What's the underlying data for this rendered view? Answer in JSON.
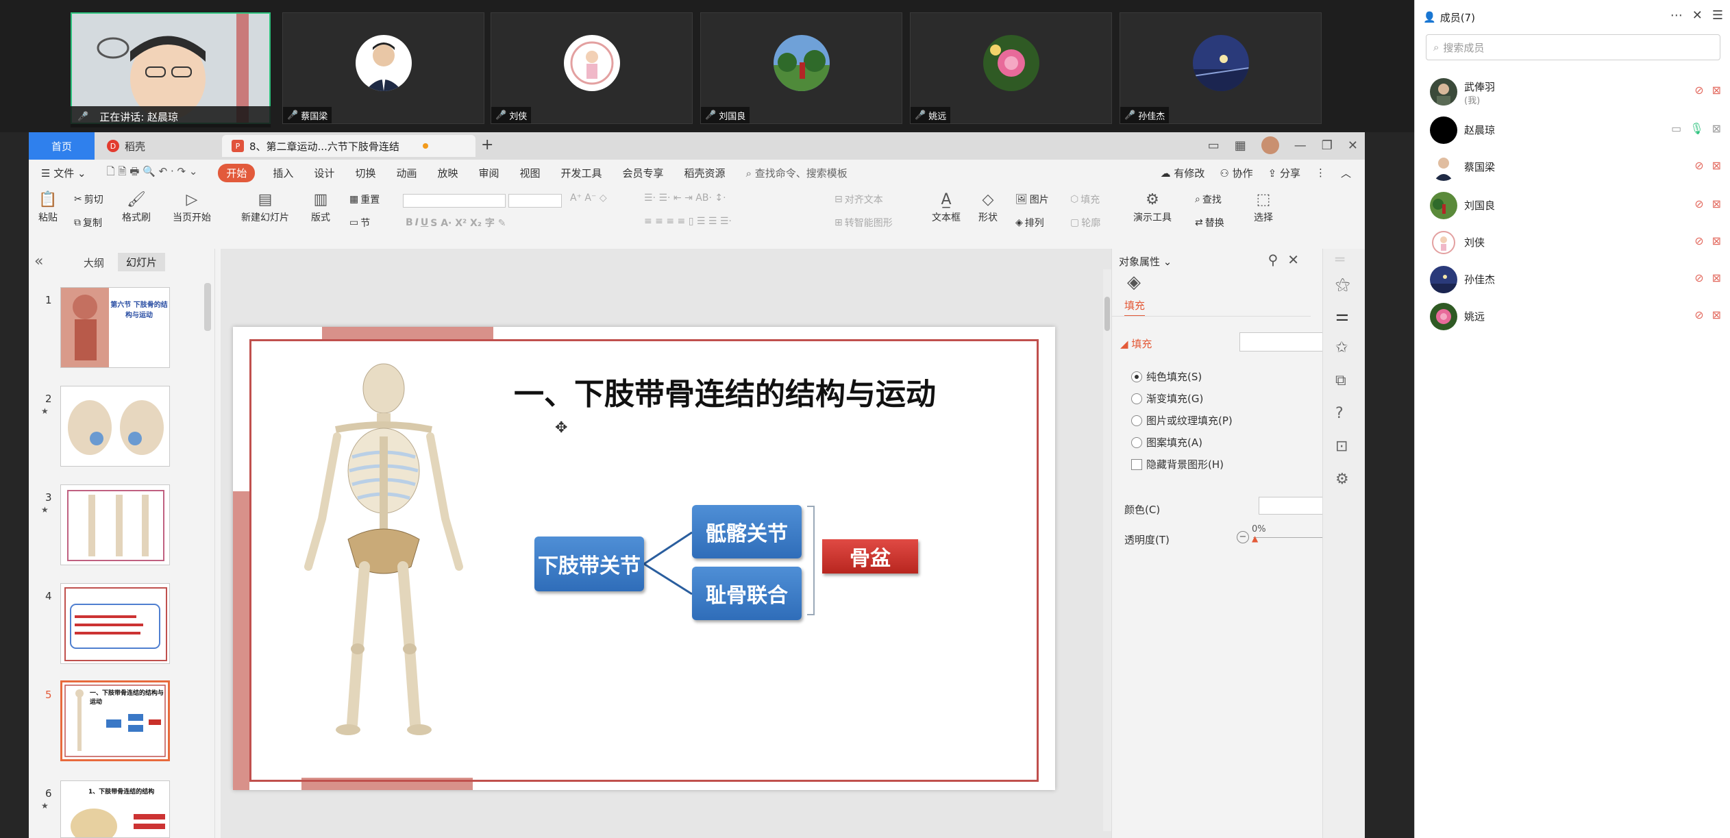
{
  "video_strip": {
    "speaking_label": "正在讲话: 赵晨琼",
    "tiles": [
      {
        "name": "蔡国梁"
      },
      {
        "name": "刘侠"
      },
      {
        "name": "刘国良"
      },
      {
        "name": "姚远"
      },
      {
        "name": "孙佳杰"
      }
    ]
  },
  "tabs": {
    "home": "首页",
    "docer": "稻壳",
    "document": "8、第二章运动...六节下肢骨连结",
    "add": "+"
  },
  "menu": {
    "file": "文件",
    "start": "开始",
    "insert": "插入",
    "design": "设计",
    "transition": "切换",
    "animation": "动画",
    "slideshow": "放映",
    "review": "审阅",
    "view": "视图",
    "devtools": "开发工具",
    "member": "会员专享",
    "docer_res": "稻壳资源",
    "search": "查找命令、搜索模板",
    "has_changes": "有修改",
    "collab": "协作",
    "share": "分享"
  },
  "ribbon": {
    "paste": "粘贴",
    "cut": "剪切",
    "copy": "复制",
    "format_painter": "格式刷",
    "play_current": "当页开始",
    "new_slide": "新建幻灯片",
    "layout": "版式",
    "section": "节",
    "reset": "重置",
    "align_text": "对齐文本",
    "smart_art": "转智能图形",
    "textbox": "文本框",
    "shapes": "形状",
    "picture": "图片",
    "arrange": "排列",
    "fill": "填充",
    "outline": "轮廓",
    "presenter_tools": "演示工具",
    "find": "查找",
    "replace": "替换",
    "select": "选择"
  },
  "slide_panel": {
    "outline_tab": "大纲",
    "slides_tab": "幻灯片",
    "thumbs": [
      {
        "num": "1",
        "star": false,
        "title": "第六节 下肢骨的结构与运动"
      },
      {
        "num": "2",
        "star": true,
        "title": ""
      },
      {
        "num": "3",
        "star": true,
        "title": ""
      },
      {
        "num": "4",
        "star": false,
        "title": ""
      },
      {
        "num": "5",
        "star": false,
        "title": "一、下肢带骨连结的结构与运动"
      },
      {
        "num": "6",
        "star": true,
        "title": "1、下肢带骨连结的结构"
      }
    ]
  },
  "slide": {
    "title": "一、下肢带骨连结的结构与运动",
    "root_box": "下肢带关节",
    "branch_top": "骶髂关节",
    "branch_bottom": "耻骨联合",
    "result_box": "骨盆"
  },
  "properties": {
    "title": "对象属性",
    "fill_tab": "填充",
    "fill_section": "填充",
    "options": [
      {
        "label": "纯色填充(S)",
        "type": "radio",
        "checked": true
      },
      {
        "label": "渐变填充(G)",
        "type": "radio",
        "checked": false
      },
      {
        "label": "图片或纹理填充(P)",
        "type": "radio",
        "checked": false
      },
      {
        "label": "图案填充(A)",
        "type": "radio",
        "checked": false
      },
      {
        "label": "隐藏背景图形(H)",
        "type": "checkbox",
        "checked": false
      }
    ],
    "color_label": "颜色(C)",
    "transparency_label": "透明度(T)",
    "transparency_value": "0%"
  },
  "members": {
    "header": "成员(7)",
    "search_placeholder": "搜索成员",
    "list": [
      {
        "name": "武俸羽",
        "sub": "(我)",
        "mic": "muted",
        "cam": "off"
      },
      {
        "name": "赵晨琼",
        "sub": "",
        "mic": "on",
        "cam": "off"
      },
      {
        "name": "蔡国梁",
        "sub": "",
        "mic": "muted",
        "cam": "off"
      },
      {
        "name": "刘国良",
        "sub": "",
        "mic": "muted",
        "cam": "off"
      },
      {
        "name": "刘侠",
        "sub": "",
        "mic": "muted",
        "cam": "off"
      },
      {
        "name": "孙佳杰",
        "sub": "",
        "mic": "muted",
        "cam": "off"
      },
      {
        "name": "姚远",
        "sub": "",
        "mic": "muted",
        "cam": "off"
      }
    ]
  },
  "colors": {
    "accent": "#e25a3b",
    "home_tab": "#2f80ed",
    "slide_border": "#c0504d",
    "box_blue": "#3a78c6",
    "box_red": "#c9302a",
    "speaking": "#2ec27e"
  }
}
